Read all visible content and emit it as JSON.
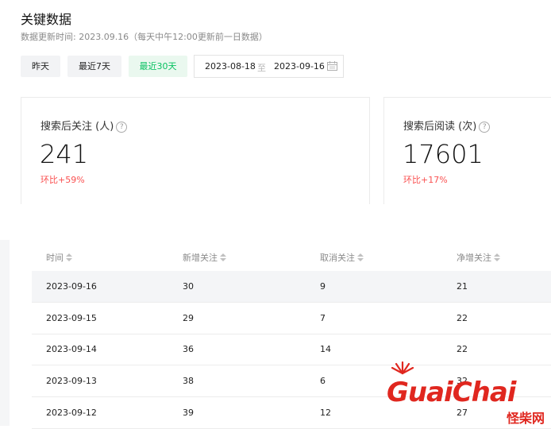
{
  "header": {
    "title": "关键数据",
    "subtitle": "数据更新时间: 2023.09.16（每天中午12:00更新前一日数据）"
  },
  "filters": {
    "yesterday": "昨天",
    "last7": "最近7天",
    "last30": "最近30天",
    "active": "最近30天",
    "date_start": "2023-08-18",
    "date_sep": "至",
    "date_end": "2023-09-16"
  },
  "cards": [
    {
      "label": "搜索后关注 (人)",
      "value": "241",
      "change": "环比+59%"
    },
    {
      "label": "搜索后阅读 (次)",
      "value": "17601",
      "change": "环比+17%"
    }
  ],
  "table": {
    "columns": [
      "时间",
      "新增关注",
      "取消关注",
      "净增关注"
    ],
    "rows": [
      [
        "2023-09-16",
        "30",
        "9",
        "21"
      ],
      [
        "2023-09-15",
        "29",
        "7",
        "22"
      ],
      [
        "2023-09-14",
        "36",
        "14",
        "22"
      ],
      [
        "2023-09-13",
        "38",
        "6",
        "32"
      ],
      [
        "2023-09-12",
        "39",
        "12",
        "27"
      ]
    ]
  },
  "watermark": {
    "text": "GuaiChai",
    "cn": "怪柴网"
  },
  "colors": {
    "accent_green": "#07c160",
    "change_red": "#fa5151",
    "watermark_red": "#e0271f"
  }
}
